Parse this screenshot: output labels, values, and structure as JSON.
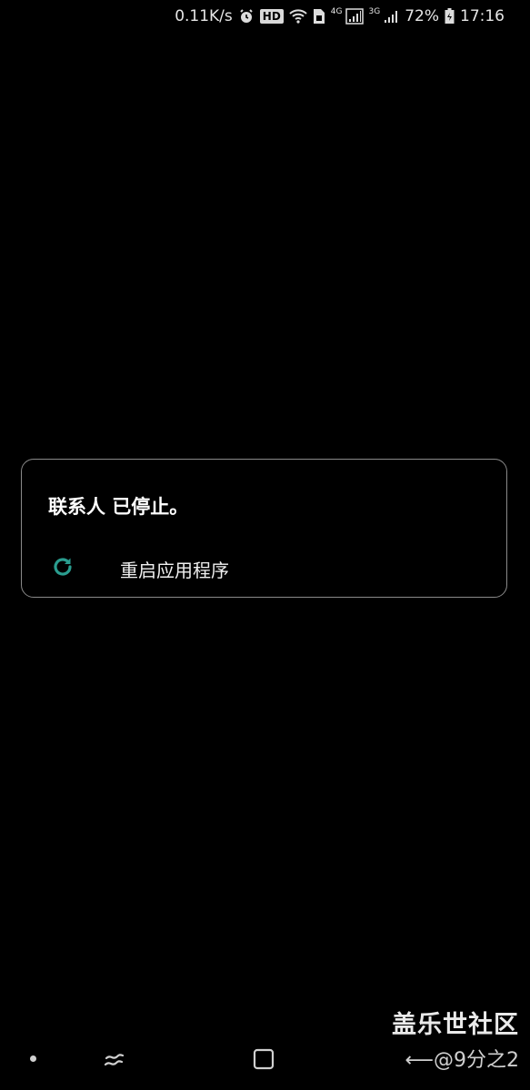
{
  "status_bar": {
    "net_speed": "0.11K/s",
    "hd_badge": "HD",
    "net_4g": "4G",
    "net_3g": "3G",
    "battery": "72%",
    "time": "17:16"
  },
  "dialog": {
    "title": "联系人 已停止。",
    "action_label": "重启应用程序",
    "accent_color": "#2a9d8f"
  },
  "nav_bar": {
    "recent_icon": "recent-apps-icon",
    "home_icon": "home-icon"
  },
  "watermark": {
    "title": "盖乐世社区",
    "subtitle": "@9分之2"
  }
}
